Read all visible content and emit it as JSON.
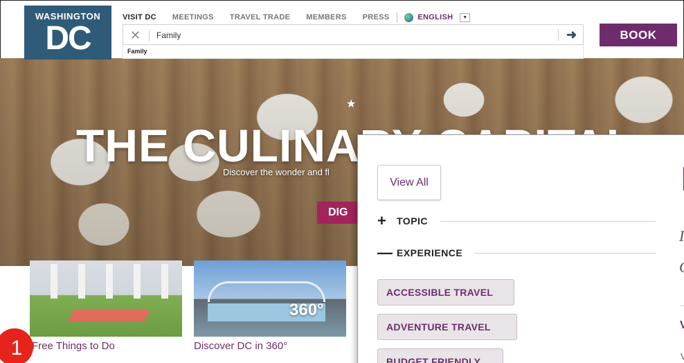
{
  "logo": {
    "top": "washington",
    "dc": "DC"
  },
  "topnav": {
    "items": [
      "VISIT DC",
      "MEETINGS",
      "TRAVEL TRADE",
      "MEMBERS",
      "PRESS"
    ],
    "language": "ENGLISH"
  },
  "search": {
    "value": "Family",
    "suggestion": "Family"
  },
  "book_label": "BOOK",
  "hero": {
    "title": "THE CULINARY CAPITAL",
    "subtitle": "Discover the wonder and fl",
    "button": "DIG"
  },
  "cards": [
    {
      "title": "Free Things to Do"
    },
    {
      "title": "Discover DC in 360°",
      "badge": "360°"
    }
  ],
  "step_number": "1",
  "filters": {
    "view_all": "View All",
    "facets": [
      {
        "sign": "+",
        "label": "TOPIC"
      },
      {
        "sign": "—",
        "label": "EXPERIENCE"
      }
    ],
    "tags": [
      "ACCESSIBLE TRAVEL",
      "ADVENTURE TRAVEL",
      "BUDGET FRIENDLY"
    ]
  },
  "panel_right": {
    "glyph1": "I",
    "glyph2": "C",
    "heading_fragment": "V",
    "text_fragment": "V"
  },
  "colors": {
    "brand_purple": "#6e2c6c",
    "logo_blue": "#2f5b78",
    "hero_button": "#a3245a",
    "step_badge": "#e8231c"
  },
  "icons": {
    "clear": "close-icon",
    "go": "arrow-right-icon",
    "globe": "globe-icon",
    "dropdown": "caret-down-icon"
  }
}
